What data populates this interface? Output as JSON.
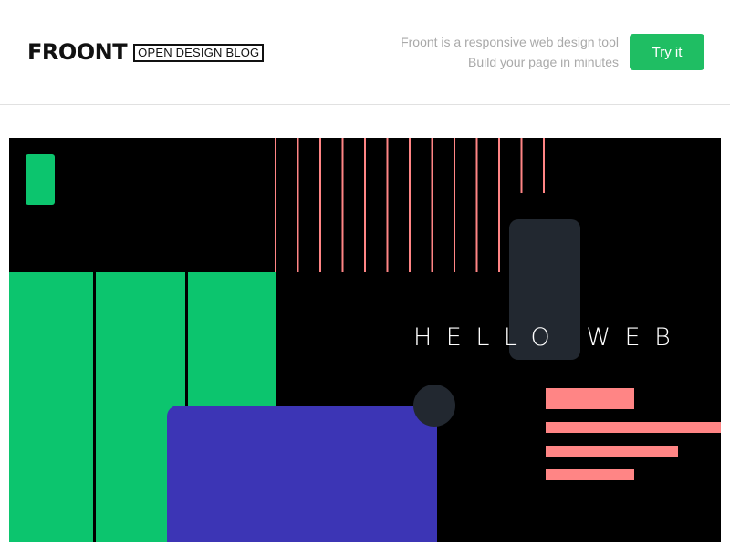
{
  "header": {
    "logo_word": "FROONT",
    "logo_badge": "OPEN DESIGN BLOG",
    "tagline_line1": "Froont is a responsive web design tool",
    "tagline_line2": "Build your page in minutes",
    "cta_label": "Try it"
  },
  "hero": {
    "headline": "HELLO WEB",
    "colors": {
      "background": "#000000",
      "green": "#0cc56e",
      "salmon": "#ff8585",
      "indigo": "#3c35b5",
      "slate": "#222830"
    }
  },
  "colors": {
    "accent": "#1fbe63",
    "muted_text": "#a9a9a9"
  }
}
